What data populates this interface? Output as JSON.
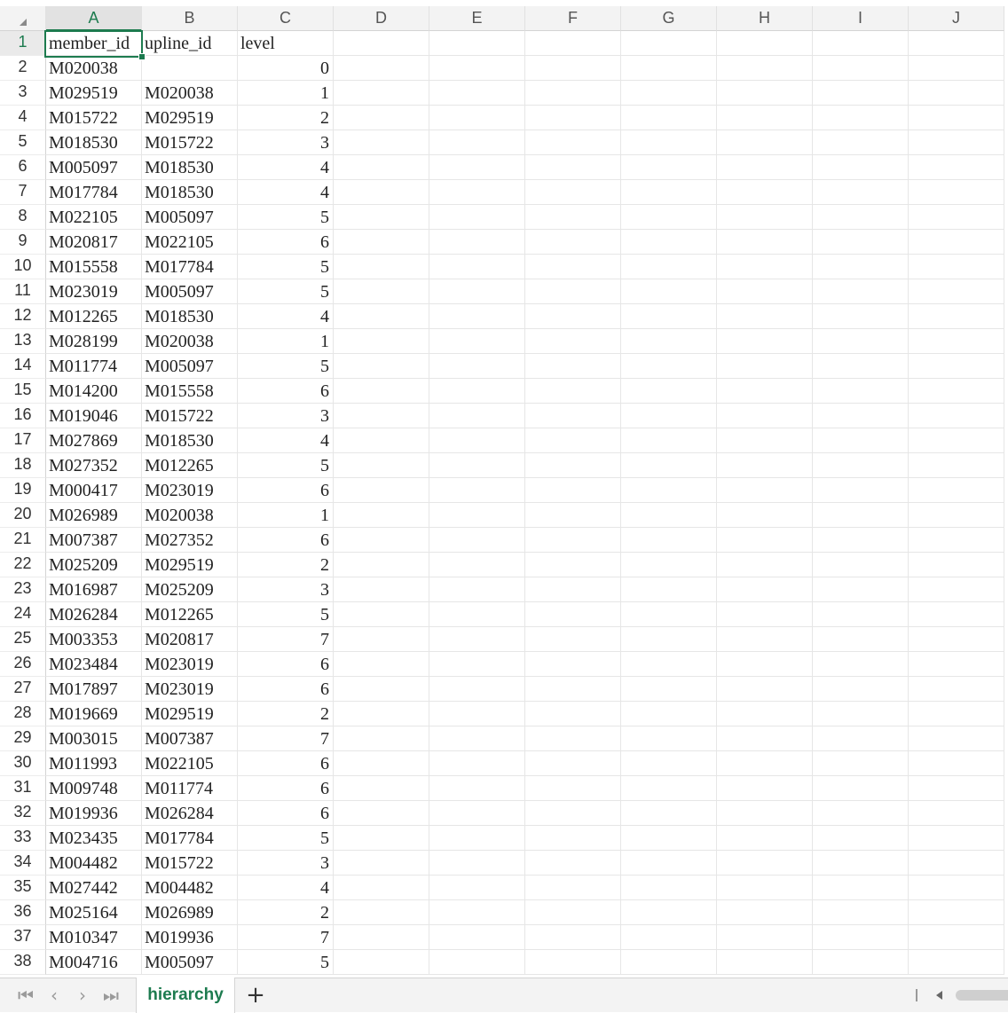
{
  "columns": [
    "A",
    "B",
    "C",
    "D",
    "E",
    "F",
    "G",
    "H",
    "I",
    "J"
  ],
  "active_column": "A",
  "active_row": 1,
  "rows": [
    [
      "member_id",
      "upline_id",
      "level"
    ],
    [
      "M020038",
      "",
      "0"
    ],
    [
      "M029519",
      "M020038",
      "1"
    ],
    [
      "M015722",
      "M029519",
      "2"
    ],
    [
      "M018530",
      "M015722",
      "3"
    ],
    [
      "M005097",
      "M018530",
      "4"
    ],
    [
      "M017784",
      "M018530",
      "4"
    ],
    [
      "M022105",
      "M005097",
      "5"
    ],
    [
      "M020817",
      "M022105",
      "6"
    ],
    [
      "M015558",
      "M017784",
      "5"
    ],
    [
      "M023019",
      "M005097",
      "5"
    ],
    [
      "M012265",
      "M018530",
      "4"
    ],
    [
      "M028199",
      "M020038",
      "1"
    ],
    [
      "M011774",
      "M005097",
      "5"
    ],
    [
      "M014200",
      "M015558",
      "6"
    ],
    [
      "M019046",
      "M015722",
      "3"
    ],
    [
      "M027869",
      "M018530",
      "4"
    ],
    [
      "M027352",
      "M012265",
      "5"
    ],
    [
      "M000417",
      "M023019",
      "6"
    ],
    [
      "M026989",
      "M020038",
      "1"
    ],
    [
      "M007387",
      "M027352",
      "6"
    ],
    [
      "M025209",
      "M029519",
      "2"
    ],
    [
      "M016987",
      "M025209",
      "3"
    ],
    [
      "M026284",
      "M012265",
      "5"
    ],
    [
      "M003353",
      "M020817",
      "7"
    ],
    [
      "M023484",
      "M023019",
      "6"
    ],
    [
      "M017897",
      "M023019",
      "6"
    ],
    [
      "M019669",
      "M029519",
      "2"
    ],
    [
      "M003015",
      "M007387",
      "7"
    ],
    [
      "M011993",
      "M022105",
      "6"
    ],
    [
      "M009748",
      "M011774",
      "6"
    ],
    [
      "M019936",
      "M026284",
      "6"
    ],
    [
      "M023435",
      "M017784",
      "5"
    ],
    [
      "M004482",
      "M015722",
      "3"
    ],
    [
      "M027442",
      "M004482",
      "4"
    ],
    [
      "M025164",
      "M026989",
      "2"
    ],
    [
      "M010347",
      "M019936",
      "7"
    ],
    [
      "M004716",
      "M005097",
      "5"
    ]
  ],
  "tabbar": {
    "nav_first": "|<",
    "nav_prev": "<",
    "nav_next": ">",
    "nav_last": ">|",
    "sheet_name": "hierarchy",
    "add_sheet": "+"
  }
}
